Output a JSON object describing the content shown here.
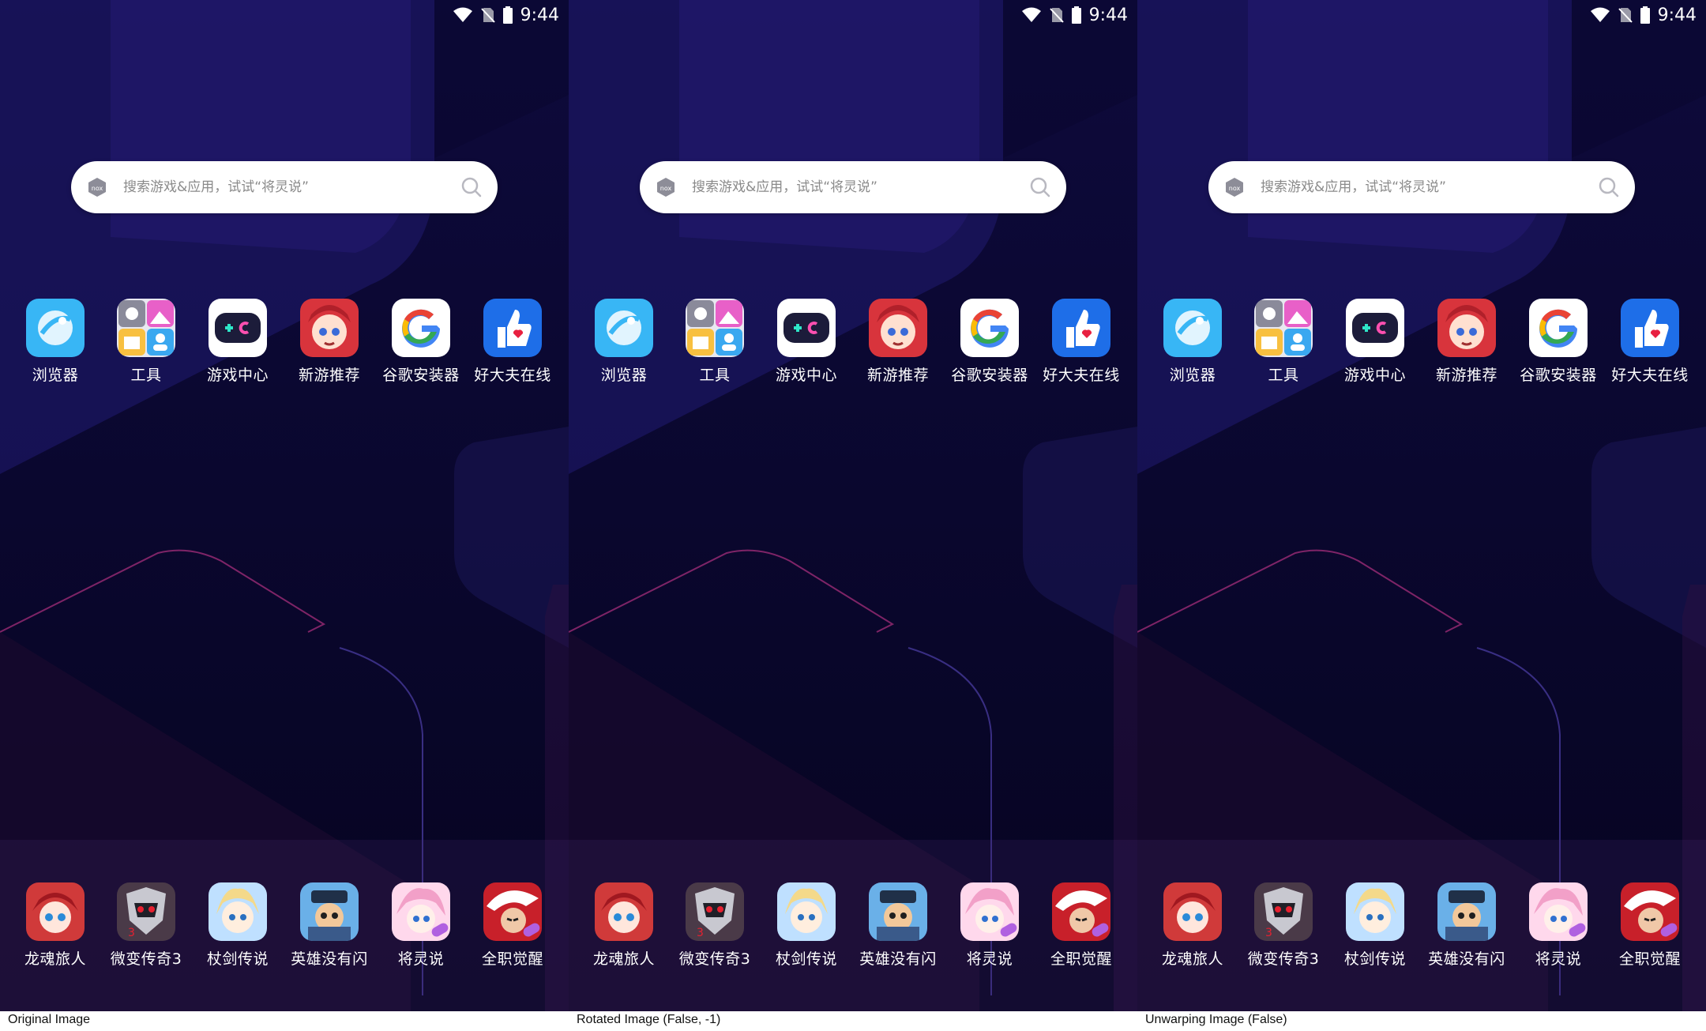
{
  "panels": [
    {
      "caption": "Original Image",
      "status": {
        "time": "9:44",
        "icons": [
          "wifi-icon",
          "no-sim-icon",
          "battery-icon"
        ]
      },
      "search": {
        "placeholder": "搜索游戏&应用，试试“将灵说”",
        "logo": "nox"
      },
      "apps": [
        {
          "label": "浏览器",
          "icon": "browser-icon",
          "color": "#38b6f5"
        },
        {
          "label": "工具",
          "icon": "tools-icon",
          "color": "#8a90ff"
        },
        {
          "label": "游戏中心",
          "icon": "gamepad-icon",
          "color": "#1c1c3a"
        },
        {
          "label": "新游推荐",
          "icon": "anime-girl-icon",
          "color": "#d8343c"
        },
        {
          "label": "谷歌安装器",
          "icon": "google-icon",
          "color": "#ffffff"
        },
        {
          "label": "好大夫在线",
          "icon": "thumbs-up-icon",
          "color": "#1e6ee8"
        }
      ],
      "dock": [
        {
          "label": "龙魂旅人",
          "icon": "longhun-icon",
          "color": "#d03a3a"
        },
        {
          "label": "微变传奇3",
          "icon": "weibian-icon",
          "color": "#4a3a48"
        },
        {
          "label": "杖剑传说",
          "icon": "zhangjian-icon",
          "color": "#f4d98a"
        },
        {
          "label": "英雄没有闪",
          "icon": "yingxiong-icon",
          "color": "#3a5a8a"
        },
        {
          "label": "将灵说",
          "icon": "jiangling-icon",
          "color": "#f2a0c8"
        },
        {
          "label": "全职觉醒",
          "icon": "quanzhi-icon",
          "color": "#c8202a"
        }
      ]
    },
    {
      "caption": "Rotated Image (False, -1)",
      "status": {
        "time": "9:44",
        "icons": [
          "wifi-icon",
          "no-sim-icon",
          "battery-icon"
        ]
      },
      "search": {
        "placeholder": "搜索游戏&应用，试试“将灵说”",
        "logo": "nox"
      },
      "apps": [
        {
          "label": "浏览器",
          "icon": "browser-icon",
          "color": "#38b6f5"
        },
        {
          "label": "工具",
          "icon": "tools-icon",
          "color": "#8a90ff"
        },
        {
          "label": "游戏中心",
          "icon": "gamepad-icon",
          "color": "#1c1c3a"
        },
        {
          "label": "新游推荐",
          "icon": "anime-girl-icon",
          "color": "#d8343c"
        },
        {
          "label": "谷歌安装器",
          "icon": "google-icon",
          "color": "#ffffff"
        },
        {
          "label": "好大夫在线",
          "icon": "thumbs-up-icon",
          "color": "#1e6ee8"
        }
      ],
      "dock": [
        {
          "label": "龙魂旅人",
          "icon": "longhun-icon",
          "color": "#d03a3a"
        },
        {
          "label": "微变传奇3",
          "icon": "weibian-icon",
          "color": "#4a3a48"
        },
        {
          "label": "杖剑传说",
          "icon": "zhangjian-icon",
          "color": "#f4d98a"
        },
        {
          "label": "英雄没有闪",
          "icon": "yingxiong-icon",
          "color": "#3a5a8a"
        },
        {
          "label": "将灵说",
          "icon": "jiangling-icon",
          "color": "#f2a0c8"
        },
        {
          "label": "全职觉醒",
          "icon": "quanzhi-icon",
          "color": "#c8202a"
        }
      ]
    },
    {
      "caption": "Unwarping Image (False)",
      "status": {
        "time": "9:44",
        "icons": [
          "wifi-icon",
          "no-sim-icon",
          "battery-icon"
        ]
      },
      "search": {
        "placeholder": "搜索游戏&应用，试试“将灵说”",
        "logo": "nox"
      },
      "apps": [
        {
          "label": "浏览器",
          "icon": "browser-icon",
          "color": "#38b6f5"
        },
        {
          "label": "工具",
          "icon": "tools-icon",
          "color": "#8a90ff"
        },
        {
          "label": "游戏中心",
          "icon": "gamepad-icon",
          "color": "#1c1c3a"
        },
        {
          "label": "新游推荐",
          "icon": "anime-girl-icon",
          "color": "#d8343c"
        },
        {
          "label": "谷歌安装器",
          "icon": "google-icon",
          "color": "#ffffff"
        },
        {
          "label": "好大夫在线",
          "icon": "thumbs-up-icon",
          "color": "#1e6ee8"
        }
      ],
      "dock": [
        {
          "label": "龙魂旅人",
          "icon": "longhun-icon",
          "color": "#d03a3a"
        },
        {
          "label": "微变传奇3",
          "icon": "weibian-icon",
          "color": "#4a3a48"
        },
        {
          "label": "杖剑传说",
          "icon": "zhangjian-icon",
          "color": "#f4d98a"
        },
        {
          "label": "英雄没有闪",
          "icon": "yingxiong-icon",
          "color": "#3a5a8a"
        },
        {
          "label": "将灵说",
          "icon": "jiangling-icon",
          "color": "#f2a0c8"
        },
        {
          "label": "全职觉醒",
          "icon": "quanzhi-icon",
          "color": "#c8202a"
        }
      ]
    }
  ]
}
